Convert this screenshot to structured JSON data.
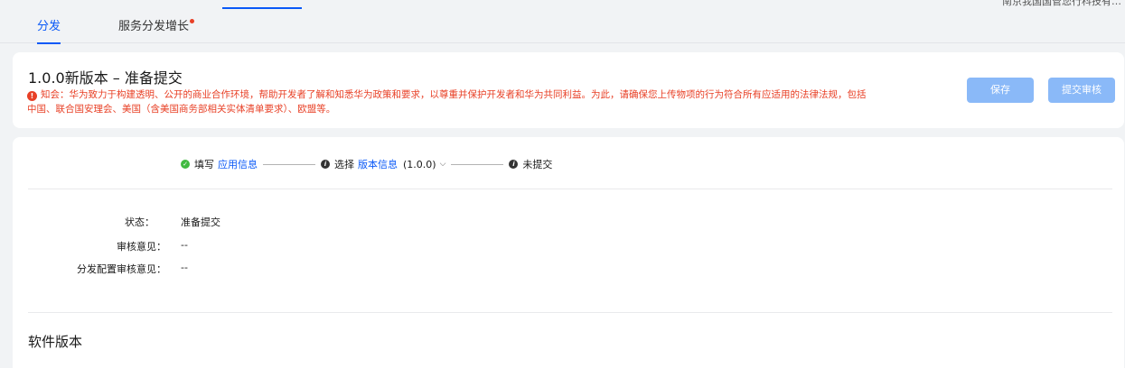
{
  "header": {
    "company_text": "南京我国国管您行科技有…"
  },
  "tabs": [
    {
      "label": "分发",
      "active": true
    },
    {
      "label": "服务分发增长",
      "badge_dot": true
    }
  ],
  "version_card": {
    "title": "1.0.0新版本 – 准备提交",
    "notice": "知会：华为致力于构建透明、公开的商业合作环境，帮助开发者了解和知悉华为政策和要求，以尊重并保护开发者和华为共同利益。为此，请确保您上传物项的行为符合所有应适用的法律法规，包括中国、联合国安理会、美国（含美国商务部相关实体清单要求）、欧盟等。",
    "save_label": "保存",
    "submit_label": "提交审核"
  },
  "steps": [
    {
      "prefix": "填写",
      "link": "应用信息",
      "status": "done"
    },
    {
      "prefix": "选择",
      "link": "版本信息",
      "suffix": "(1.0.0)",
      "status": "info"
    },
    {
      "prefix": "未提交",
      "status": "info"
    }
  ],
  "status_fields": [
    {
      "label": "状态：",
      "value": "准备提交"
    },
    {
      "label": "审核意见：",
      "value": "--"
    },
    {
      "label": "分发配置审核意见：",
      "value": "--"
    }
  ],
  "section_title": "软件版本",
  "colors": {
    "accent": "#0a59f7",
    "warning": "#e84026",
    "success": "#41ba41",
    "disabled_button": "#8ab9f8"
  }
}
